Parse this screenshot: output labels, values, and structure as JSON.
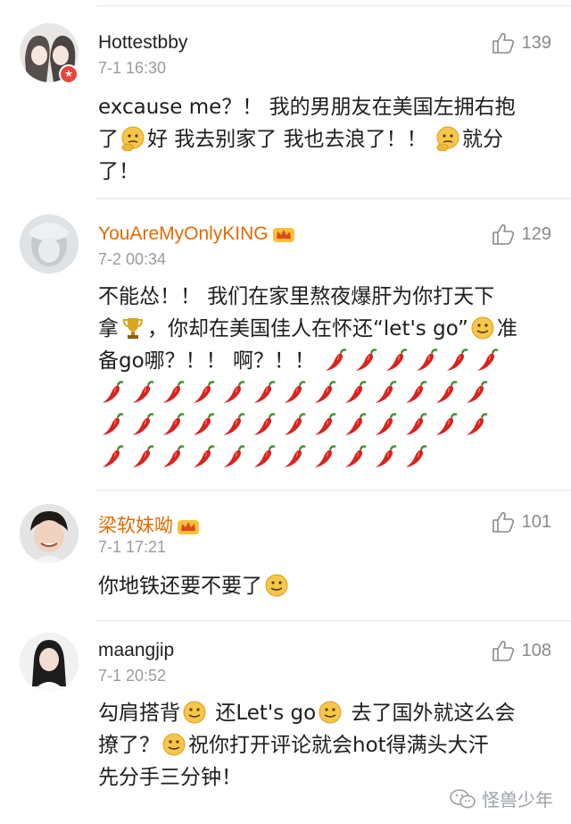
{
  "comments": [
    {
      "username": "Hottestbby",
      "time": "7-1 16:30",
      "likes": "139",
      "text_a": "excause me？！ 我的男朋友在美国左拥右抱",
      "text_b": "了",
      "text_c": "好 我去别家了 我也去浪了！！",
      "text_d": "就分",
      "text_e": "了！",
      "avatar_icon": "girl-photo-avatar",
      "badge_icon": "star-badge"
    },
    {
      "username": "YouAreMyOnlyKING",
      "time": "7-2 00:34",
      "likes": "129",
      "text_a": "不能怂！！ 我们在家里熬夜爆肝为你打天下",
      "text_b": "拿",
      "text_c": "，你却在美国佳人在怀还“let's go”",
      "text_d": "准",
      "text_e": "备go哪？！！ 啊？！！",
      "avatar_icon": "gray-photo-avatar"
    },
    {
      "username": "梁软妹呦",
      "time": "7-1 17:21",
      "likes": "101",
      "text_a": "你地铁还要不要了",
      "avatar_icon": "boy-photo-avatar"
    },
    {
      "username": "maangjip",
      "time": "7-1 20:52",
      "likes": "108",
      "text_a": "勾肩搭背",
      "text_b": "还Let's go",
      "text_c": "去了国外就这么会",
      "text_d": "撩了？",
      "text_e": "祝你打开评论就会hot得满头大汗",
      "text_f": "先分手三分钟！",
      "avatar_icon": "girl-photo-avatar"
    }
  ],
  "watermark": {
    "text": "怪兽少年",
    "icon": "wechat-icon"
  },
  "colors": {
    "vip_name": "#e06c00",
    "time": "#9b9b9b",
    "like": "#8a8a8a"
  }
}
